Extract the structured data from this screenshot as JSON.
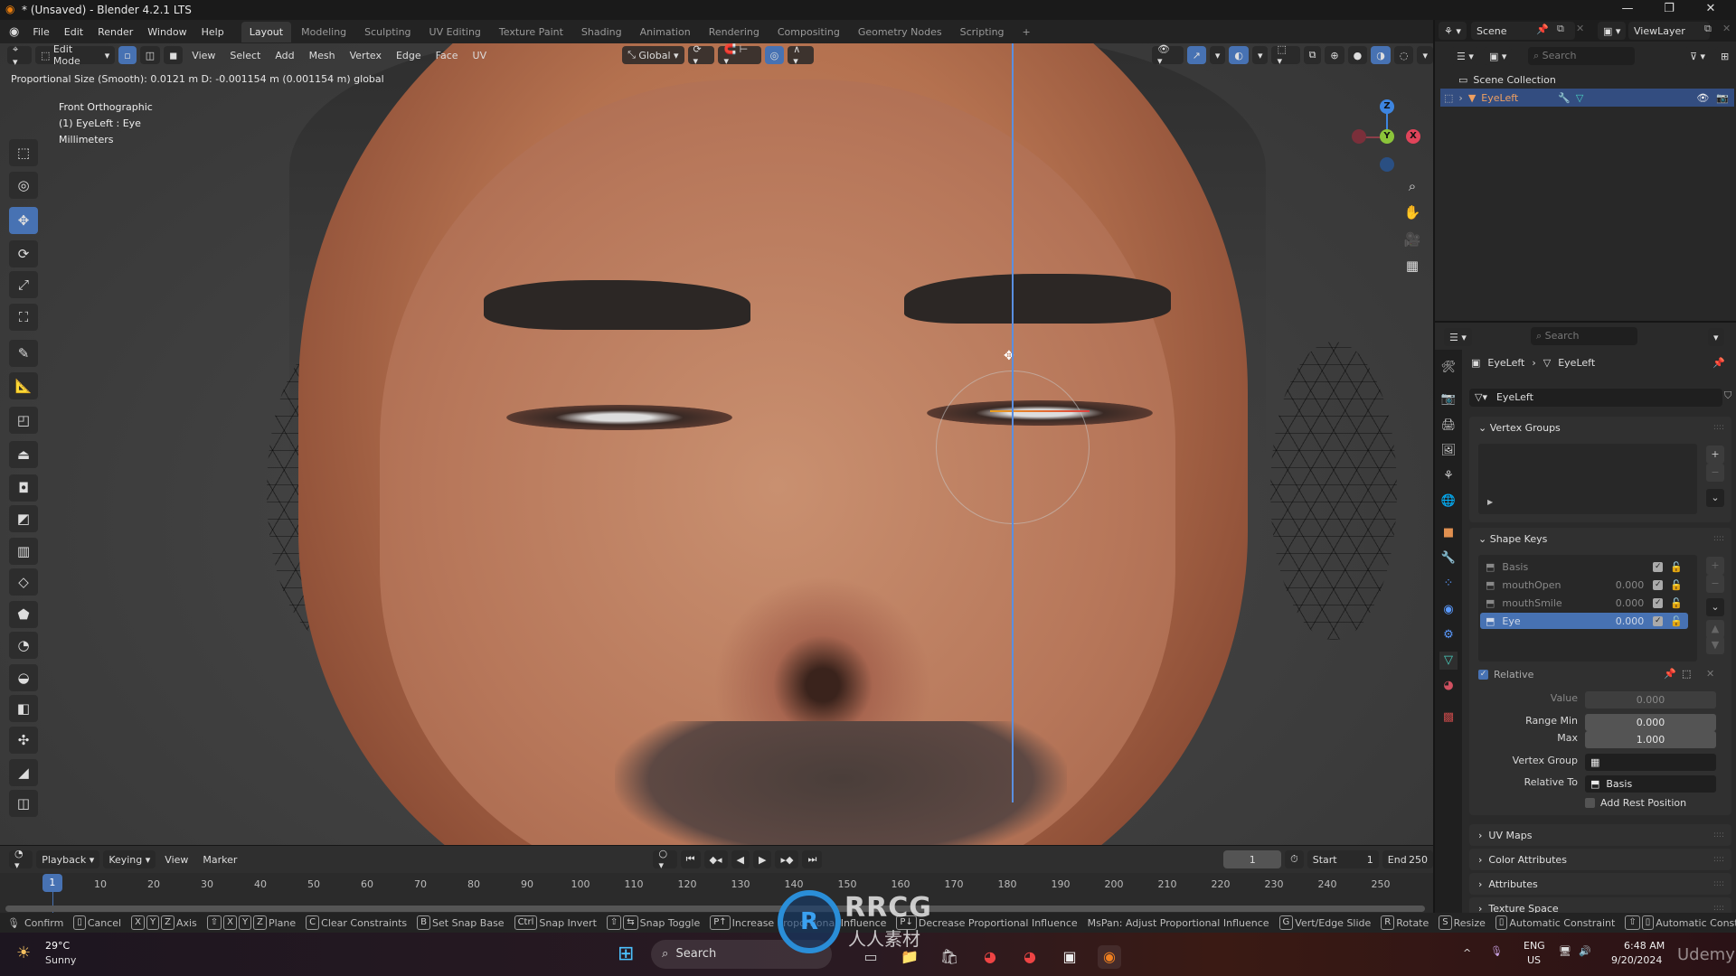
{
  "window": {
    "title": "* (Unsaved) - Blender 4.2.1 LTS",
    "controls": [
      "—",
      "❐",
      "✕"
    ]
  },
  "menu": [
    "File",
    "Edit",
    "Render",
    "Window",
    "Help"
  ],
  "workspaces": [
    {
      "label": "Layout",
      "active": true
    },
    {
      "label": "Modeling"
    },
    {
      "label": "Sculpting"
    },
    {
      "label": "UV Editing"
    },
    {
      "label": "Texture Paint"
    },
    {
      "label": "Shading"
    },
    {
      "label": "Animation"
    },
    {
      "label": "Rendering"
    },
    {
      "label": "Compositing"
    },
    {
      "label": "Geometry Nodes"
    },
    {
      "label": "Scripting"
    }
  ],
  "add_workspace": "+",
  "scene": {
    "name": "Scene",
    "view_layer": "ViewLayer"
  },
  "viewport": {
    "mode": "Edit Mode",
    "menus": [
      "View",
      "Select",
      "Add",
      "Mesh",
      "Vertex",
      "Edge",
      "Face",
      "UV"
    ],
    "orientation": "Global",
    "operator_info": "Proportional Size (Smooth): 0.0121 m  D: -0.001154 m (0.001154 m) global",
    "view_name": "Front Orthographic",
    "object_info": "(1) EyeLeft : Eye",
    "units": "Millimeters",
    "gizmo": {
      "z": "Z",
      "y": "Y",
      "x": "X"
    },
    "axis_colors": {
      "x": "#e0445a",
      "y": "#8bc43a",
      "z": "#3d85e0"
    },
    "accent": "#4772b3"
  },
  "toolbar_tools": [
    "select-box",
    "cursor",
    "move",
    "rotate",
    "scale",
    "transform",
    "annotate",
    "measure",
    "add-cube",
    "extrude",
    "inset",
    "bevel",
    "loop-cut",
    "knife",
    "poly-build",
    "spin",
    "smooth",
    "shrink-fatten",
    "push-pull",
    "shear",
    "rip"
  ],
  "outliner": {
    "search_placeholder": "Search",
    "scene_collection": "Scene Collection",
    "object": "EyeLeft"
  },
  "properties": {
    "search_placeholder": "Search",
    "breadcrumb": [
      "EyeLeft",
      "EyeLeft"
    ],
    "mesh_name": "EyeLeft",
    "vertex_groups_title": "Vertex Groups",
    "shape_keys_title": "Shape Keys",
    "shape_keys": [
      {
        "name": "Basis",
        "value": ""
      },
      {
        "name": "mouthOpen",
        "value": "0.000"
      },
      {
        "name": "mouthSmile",
        "value": "0.000"
      },
      {
        "name": "Eye",
        "value": "0.000",
        "selected": true
      }
    ],
    "relative_label": "Relative",
    "value_label": "Value",
    "value": "0.000",
    "range_min_label": "Range Min",
    "range_min": "0.000",
    "max_label": "Max",
    "max": "1.000",
    "vertex_group_label": "Vertex Group",
    "relative_to_label": "Relative To",
    "relative_to": "Basis",
    "add_rest_position": "Add Rest Position",
    "collapsed_panels": [
      "UV Maps",
      "Color Attributes",
      "Attributes",
      "Texture Space"
    ]
  },
  "timeline": {
    "menus": [
      "Playback",
      "Keying",
      "View",
      "Marker"
    ],
    "current_frame": "1",
    "start_label": "Start",
    "start": "1",
    "end_label": "End",
    "end": "250",
    "ticks": [
      10,
      20,
      30,
      40,
      50,
      60,
      70,
      80,
      90,
      100,
      110,
      120,
      130,
      140,
      150,
      160,
      170,
      180,
      190,
      200,
      210,
      220,
      230,
      240,
      250
    ]
  },
  "statusbar": [
    {
      "keys": [],
      "label": "Confirm"
    },
    {
      "keys": [
        "▯"
      ],
      "label": "Cancel"
    },
    {
      "keys": [
        "X",
        "Y",
        "Z"
      ],
      "label": "Axis"
    },
    {
      "keys": [
        "⇧",
        "X",
        "Y",
        "Z"
      ],
      "label": "Plane"
    },
    {
      "keys": [
        "C"
      ],
      "label": "Clear Constraints"
    },
    {
      "keys": [
        "B"
      ],
      "label": "Set Snap Base"
    },
    {
      "keys": [
        "Ctrl"
      ],
      "label": "Snap Invert"
    },
    {
      "keys": [
        "⇧",
        "⇆"
      ],
      "label": "Snap Toggle"
    },
    {
      "keys": [
        "P↑"
      ],
      "label": "Increase Proportional Influence"
    },
    {
      "keys": [
        "P↓"
      ],
      "label": "Decrease Proportional Influence"
    },
    {
      "keys": [],
      "label": "MsPan: Adjust Proportional Influence"
    },
    {
      "keys": [
        "G"
      ],
      "label": "Vert/Edge Slide"
    },
    {
      "keys": [
        "R"
      ],
      "label": "Rotate"
    },
    {
      "keys": [
        "S"
      ],
      "label": "Resize"
    },
    {
      "keys": [
        "▯"
      ],
      "label": "Automatic Constraint"
    },
    {
      "keys": [
        "⇧",
        "▯"
      ],
      "label": "Automatic Constraint Plane"
    }
  ],
  "taskbar": {
    "weather_temp": "29°C",
    "weather_desc": "Sunny",
    "search": "Search",
    "lang": "ENG",
    "region": "US",
    "time": "6:48 AM",
    "date": "9/20/2024"
  },
  "watermark": {
    "logo": "RRCG",
    "logo_sub": "人人素材",
    "brand": "Udemy"
  }
}
